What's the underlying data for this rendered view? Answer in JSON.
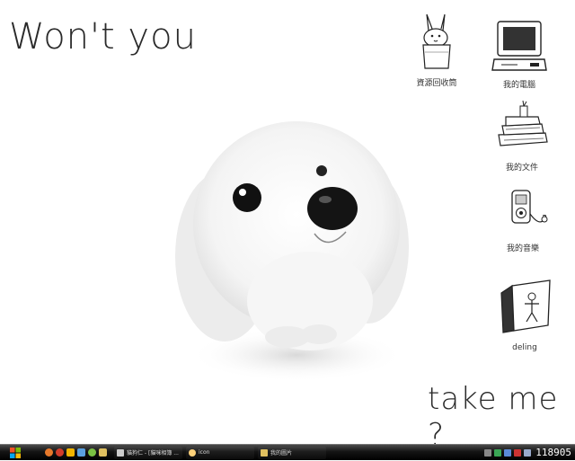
{
  "wallpaper": {
    "slogan_top": "Won't you",
    "slogan_bottom": "take me ?"
  },
  "desktop_icons": [
    {
      "label": "資源回收筒",
      "icon": "recycle-bin-bunny-icon"
    },
    {
      "label": "我的電腦",
      "icon": "my-computer-icon"
    },
    {
      "label": "我的文件",
      "icon": "my-documents-icon"
    },
    {
      "label": "我的音樂",
      "icon": "my-music-icon"
    },
    {
      "label": "deling",
      "icon": "folder-stickman-icon"
    }
  ],
  "taskbar": {
    "start_icon": "windows-logo-icon",
    "quick_launch": [
      "firefox-icon",
      "browser-icon",
      "media-icon",
      "app-icon",
      "chat-icon",
      "folder-icon"
    ],
    "tasks": [
      {
        "label": "貓狗仁 - [貓咪相簿 ...",
        "icon": "app-window-icon"
      },
      {
        "label": "icon",
        "icon": "chat-icon"
      },
      {
        "label": "我的圖片",
        "icon": "folder-icon"
      }
    ],
    "tray_icons": [
      "network-icon",
      "antivirus-icon",
      "volume-icon",
      "ime-icon",
      "input-icon"
    ],
    "clock": "118905"
  },
  "colors": {
    "taskbar": "#141414",
    "text": "#2a2a2a"
  }
}
